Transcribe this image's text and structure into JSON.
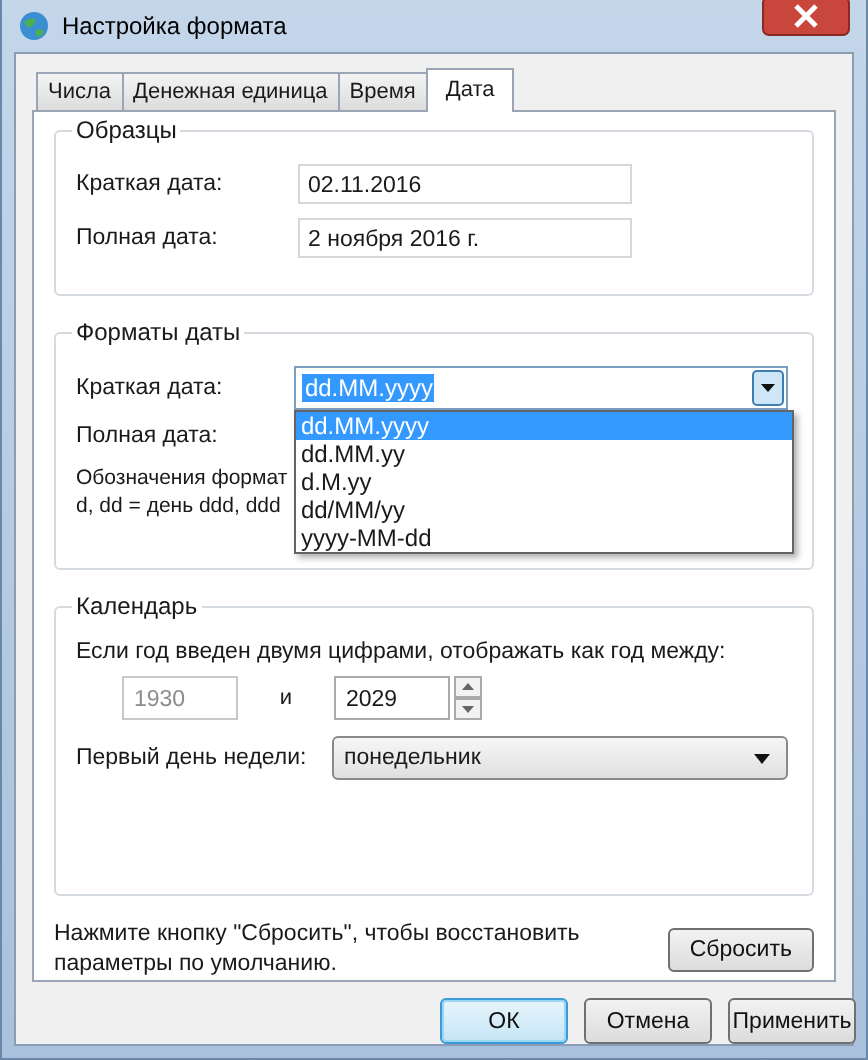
{
  "window": {
    "title": "Настройка формата"
  },
  "tabs": [
    {
      "label": "Числа",
      "selected": false
    },
    {
      "label": "Денежная единица",
      "selected": false
    },
    {
      "label": "Время",
      "selected": false
    },
    {
      "label": "Дата",
      "selected": true
    }
  ],
  "samples": {
    "title": "Образцы",
    "rows": [
      {
        "label": "Краткая дата:",
        "value": "02.11.2016"
      },
      {
        "label": "Полная дата:",
        "value": "2 ноября 2016 г."
      }
    ]
  },
  "date_formats": {
    "title": "Форматы даты",
    "short_date": {
      "label": "Краткая дата:",
      "value": "dd.MM.yyyy",
      "expanded": true,
      "options": [
        {
          "label": "dd.MM.yyyy",
          "selected": true
        },
        {
          "label": "dd.MM.yy",
          "selected": false
        },
        {
          "label": "d.M.yy",
          "selected": false
        },
        {
          "label": "dd/MM/yy",
          "selected": false
        },
        {
          "label": "yyyy-MM-dd",
          "selected": false
        }
      ]
    },
    "long_date": {
      "label": "Полная дата:"
    },
    "notation": [
      "Обозначения формат",
      "d, dd = день  ddd, ddd"
    ]
  },
  "calendar": {
    "title": "Календарь",
    "two_digit_label": "Если год введен двумя цифрами, отображать как год между:",
    "from": {
      "value": "1930",
      "disabled": true
    },
    "and": "и",
    "to": {
      "value": "2029",
      "disabled": false
    },
    "first_day": {
      "label": "Первый день недели:",
      "value": "понедельник"
    }
  },
  "reset": {
    "text": "Нажмите кнопку \"Сбросить\", чтобы восстановить параметры по умолчанию.",
    "button": "Сбросить"
  },
  "buttons": [
    {
      "label": "ОК",
      "default": true
    },
    {
      "label": "Отмена",
      "default": false
    },
    {
      "label": "Применить",
      "default": false
    }
  ]
}
